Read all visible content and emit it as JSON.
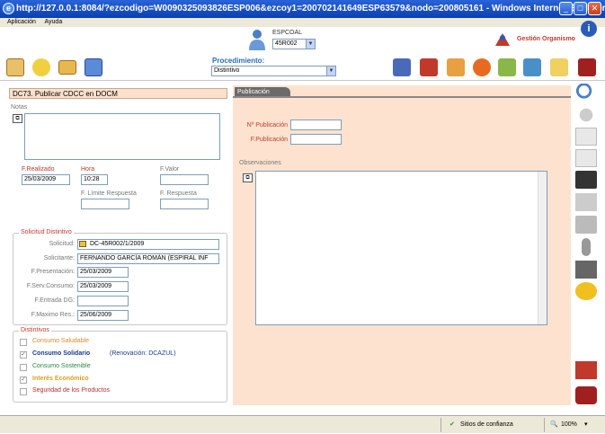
{
  "window": {
    "title": "http://127.0.0.1:8084/?ezcodigo=W0090325093826ESP006&ezcoy1=200702141649ESP63579&nodo=200805161 - Windows Internet Explorer"
  },
  "menu": {
    "aplicacion": "Aplicación",
    "ayuda": "Ayuda"
  },
  "header": {
    "espcoal": "ESPCOAL",
    "unit_value": "45R002",
    "org_label": "Gestión Organismo",
    "info": "i"
  },
  "procedimiento": {
    "label": "Procedimiento:",
    "value": "Distintivo"
  },
  "left": {
    "title": "DC73. Publicar CDCC en DOCM",
    "notas_label": "Notas",
    "f_realizado_label": "F.Realizado",
    "f_realizado_value": "25/03/2009",
    "hora_label": "Hora",
    "hora_value": "10:28",
    "f_valor_label": "F.Valor",
    "f_limite_label": "F. Límite Respuesta",
    "f_respuesta_label": "F. Respuesta"
  },
  "solicitud": {
    "legend": "Solicitud Distintivo",
    "solicitud_label": "Solicitud:",
    "solicitud_value": "DC-45R002/1/2009",
    "solicitante_label": "Solicitante:",
    "solicitante_value": "FERNANDO GARCÍA ROMÁN (ESPIRAL INF",
    "f_presentacion_label": "F.Presentación:",
    "f_presentacion_value": "25/03/2009",
    "f_serv_label": "F.Serv.Consumo:",
    "f_serv_value": "25/03/2009",
    "f_entrada_label": "F.Entrada DG:",
    "f_entrada_value": "",
    "f_maximo_label": "F.Maximo Res.:",
    "f_maximo_value": "25/06/2009"
  },
  "distintivos": {
    "legend": "Distintivos",
    "items": [
      {
        "label": "Consumo Saludable",
        "checked": false,
        "color": "#e08a2a",
        "bold": false
      },
      {
        "label": "Consumo Solidario",
        "extra": "(Renovación: DCAZUL)",
        "checked": true,
        "color": "#1a3a8a",
        "bold": true
      },
      {
        "label": "Consumo Sostenible",
        "checked": false,
        "color": "#2a8a3a",
        "bold": false
      },
      {
        "label": "Interés Económico",
        "checked": true,
        "color": "#d8a020",
        "bold": true
      },
      {
        "label": "Seguridad de los Productos",
        "checked": false,
        "color": "#b03030",
        "bold": false
      }
    ]
  },
  "publicacion": {
    "tab": "Publicación",
    "n_publicacion_label": "Nº Publicación",
    "f_publicacion_label": "F.Publicación",
    "observaciones_label": "Observaciones"
  },
  "status": {
    "zone": "Sitios de confianza",
    "zoom": "100%"
  }
}
